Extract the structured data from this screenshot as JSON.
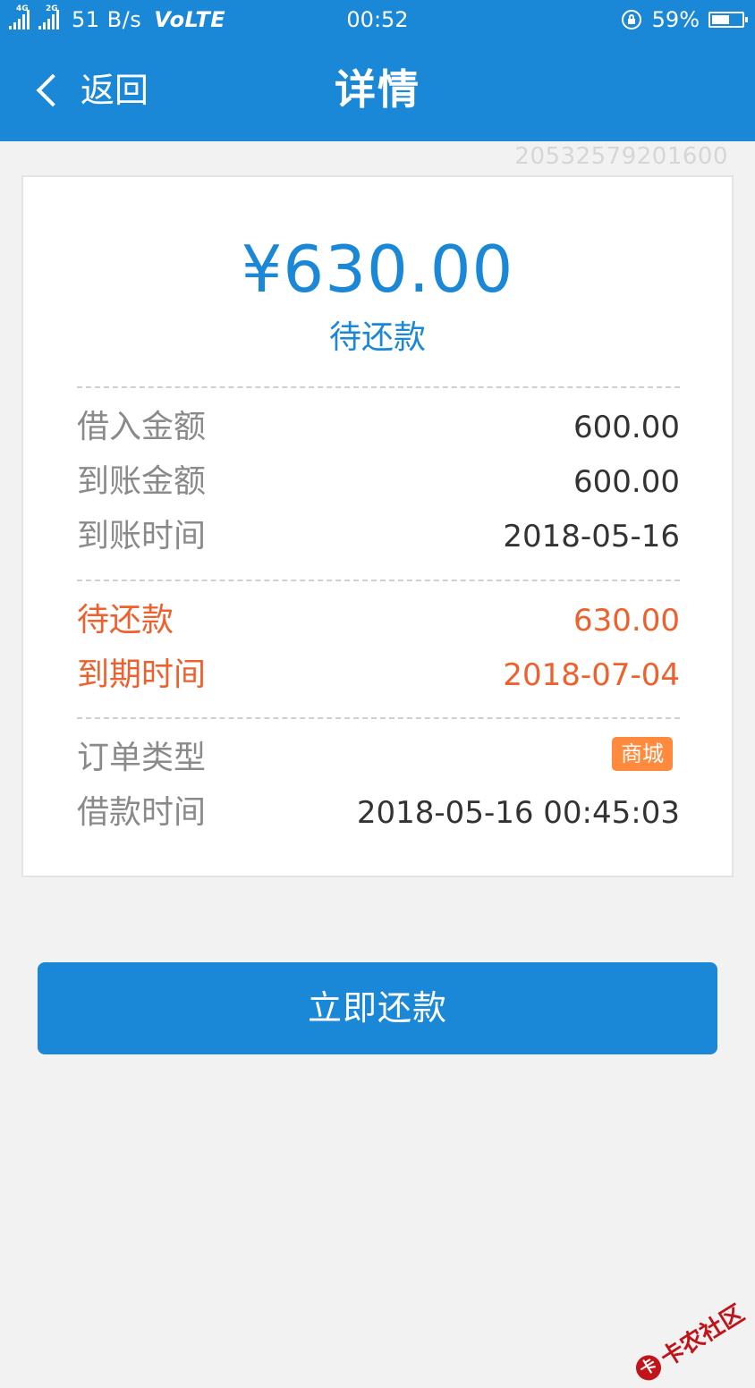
{
  "status_bar": {
    "net1": "4G",
    "net2": "2G",
    "speed": "51 B/s",
    "volte": "VoLTE",
    "time": "00:52",
    "battery": "59%",
    "battery_level": 0.59
  },
  "nav": {
    "back_label": "返回",
    "title": "详情"
  },
  "order_number": "20532579201600",
  "summary": {
    "amount": "¥630.00",
    "status": "待还款"
  },
  "loan_info": [
    {
      "label": "借入金额",
      "value": "600.00"
    },
    {
      "label": "到账金额",
      "value": "600.00"
    },
    {
      "label": "到账时间",
      "value": "2018-05-16"
    }
  ],
  "repay_info": [
    {
      "label": "待还款",
      "value": "630.00"
    },
    {
      "label": "到期时间",
      "value": "2018-07-04"
    }
  ],
  "order_info": {
    "type_label": "订单类型",
    "type_badge": "商城",
    "time_label": "借款时间",
    "time_value": "2018-05-16 00:45:03"
  },
  "actions": {
    "repay_now": "立即还款"
  },
  "watermark": {
    "logo": "卡",
    "text": "卡农社区"
  },
  "colors": {
    "primary": "#1a87d7",
    "highlight": "#f0602c",
    "badge": "#ff8a3d"
  },
  "icons": [
    "chevron-left-icon",
    "signal-icon",
    "lock-icon",
    "battery-icon"
  ]
}
